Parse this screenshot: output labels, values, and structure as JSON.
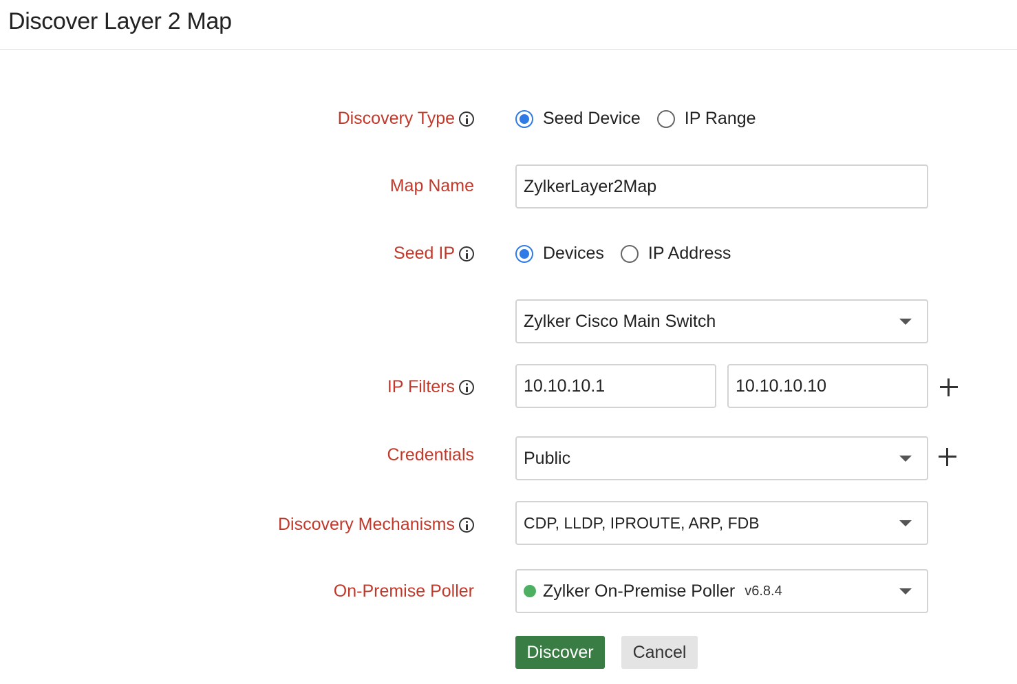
{
  "page": {
    "title": "Discover Layer 2 Map"
  },
  "discovery_type": {
    "label": "Discovery Type",
    "options": [
      "Seed Device",
      "IP Range"
    ],
    "selected": "Seed Device"
  },
  "map_name": {
    "label": "Map Name",
    "value": "ZylkerLayer2Map"
  },
  "seed_ip": {
    "label": "Seed IP",
    "options": [
      "Devices",
      "IP Address"
    ],
    "selected": "Devices",
    "device_selected": "Zylker Cisco Main Switch"
  },
  "ip_filters": {
    "label": "IP Filters",
    "from": "10.10.10.1",
    "to": "10.10.10.10"
  },
  "credentials": {
    "label": "Credentials",
    "selected": "Public"
  },
  "mechanisms": {
    "label": "Discovery Mechanisms",
    "selected": "CDP, LLDP, IPROUTE, ARP, FDB"
  },
  "poller": {
    "label": "On-Premise Poller",
    "selected": "Zylker On-Premise Poller",
    "version": "v6.8.4",
    "status_color": "#4caf62"
  },
  "actions": {
    "discover": "Discover",
    "cancel": "Cancel"
  },
  "colors": {
    "label": "#c0392b",
    "accent": "#2f7ae5",
    "primary_button": "#3a7d44"
  }
}
